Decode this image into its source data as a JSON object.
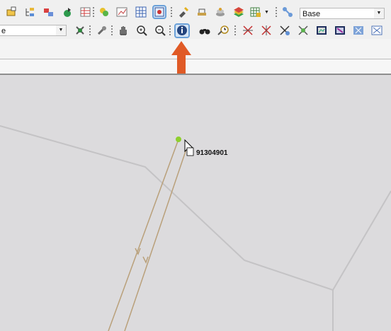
{
  "toolbar_top": {
    "layer_select_value": "Base"
  },
  "toolbar_second": {
    "field_select_value": "e"
  },
  "map": {
    "feature_label": "91304901"
  },
  "colors": {
    "toolbar_bg": "#f0f0f0",
    "map_bg": "#dcdbdd",
    "arrow": "#e05a26",
    "pipe": "#b9a07a",
    "boundary": "#c4c3c5",
    "selected_node": "#8fcf2e"
  },
  "icons": {
    "toolbar_top": [
      "layer-add-icon",
      "layer-tree-icon",
      "layer-move-icon",
      "layer-paint-icon",
      "table-icon",
      "filter-icon",
      "graph-icon",
      "grid-icon",
      "selection-icon",
      "edit-pin-icon",
      "scale-icon",
      "stack-icon",
      "layers-color-icon",
      "table-export-icon",
      "network-icon"
    ],
    "toolbar_second": [
      "tool-settings-icon",
      "wrench-icon",
      "pan-hand-icon",
      "zoom-in-icon",
      "zoom-out-icon",
      "identify-icon",
      "binoculars-icon",
      "clock-measure-icon",
      "trace-up-icon",
      "trace-down-icon",
      "trace-all-icon",
      "trace-isolate-icon",
      "map-view-icon",
      "map-select-icon",
      "map-pan-icon",
      "map-refresh-icon"
    ]
  }
}
